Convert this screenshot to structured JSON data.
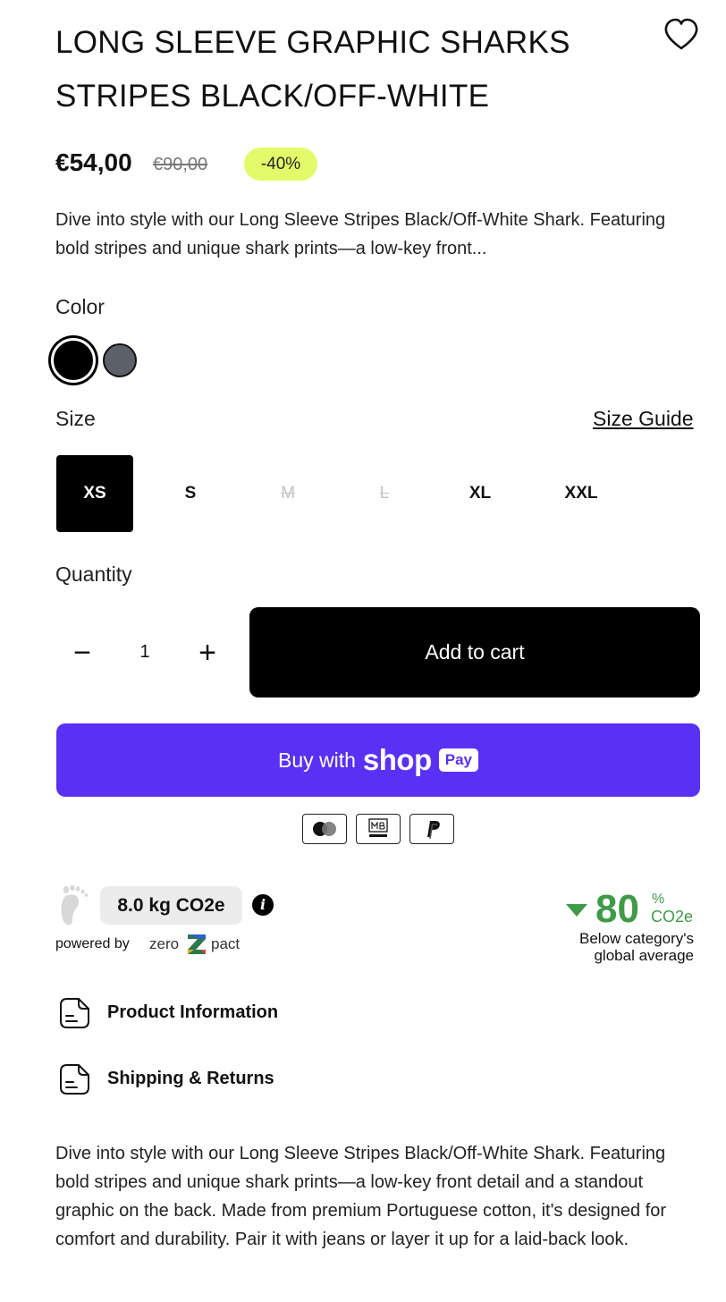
{
  "product": {
    "title": "LONG SLEEVE GRAPHIC SHARKS STRIPES BLACK/OFF-WHITE",
    "price": "€54,00",
    "compare_price": "€90,00",
    "discount_badge": "-40%",
    "short_description": "Dive into style with our Long Sleeve Stripes Black/Off-White Shark. Featuring bold stripes and unique shark prints—a low-key front..."
  },
  "color": {
    "label": "Color",
    "options": [
      {
        "name": "black",
        "hex": "#000000",
        "selected": true
      },
      {
        "name": "gray",
        "hex": "#5c6069",
        "selected": false
      }
    ]
  },
  "size": {
    "label": "Size",
    "guide_link": "Size Guide",
    "options": [
      "XS",
      "S",
      "M",
      "L",
      "XL",
      "XXL"
    ],
    "selected": "XS",
    "sold_out": [
      "M",
      "L"
    ]
  },
  "quantity": {
    "label": "Quantity",
    "value": "1",
    "minus_symbol": "−",
    "plus_symbol": "+"
  },
  "actions": {
    "add_to_cart": "Add to cart",
    "buy_with": "Buy with",
    "shop_word": "shop",
    "pay_word": "Pay",
    "shop_pay_color": "#5a31f4"
  },
  "payment_methods": [
    "mastercard-icon",
    "multibanco-icon",
    "paypal-icon"
  ],
  "sustainability": {
    "co2_value": "8.0 kg CO2e",
    "info_symbol": "i",
    "powered_by": "powered by",
    "brand_zero": "zero",
    "brand_pact": "pact",
    "percent": "80",
    "percent_sign": "%",
    "percent_unit": "CO2e",
    "comparison_text": "Below category's global average",
    "accent_color": "#3f9a4a"
  },
  "accordions": [
    {
      "label": "Product Information"
    },
    {
      "label": "Shipping & Returns"
    }
  ],
  "long_description": "Dive into style with our Long Sleeve Stripes Black/Off-White Shark. Featuring bold stripes and unique shark prints—a low-key front detail and a standout graphic on the back. Made from premium Portuguese cotton, it's designed for comfort and durability. Pair it with jeans or layer it up for a laid-back look.",
  "colors": {
    "discount_bg": "#e3fb6a",
    "primary": "#000000",
    "co2_badge_bg": "#ececec"
  }
}
